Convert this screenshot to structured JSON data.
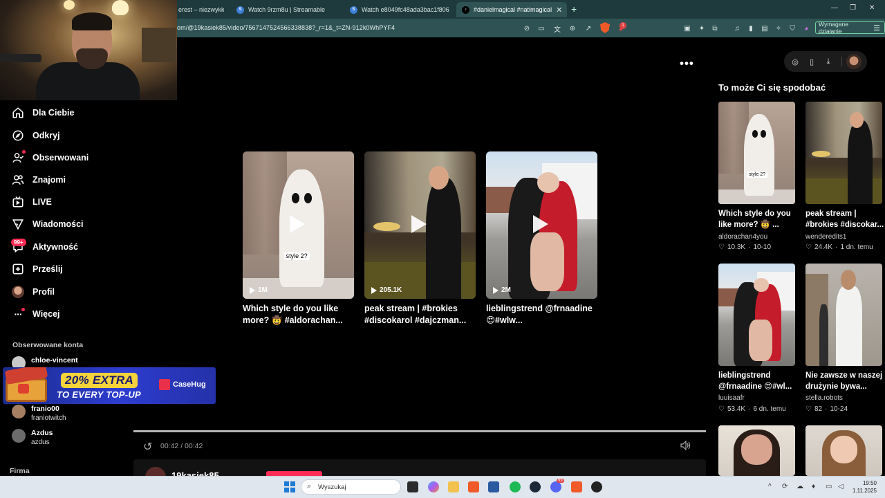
{
  "browser": {
    "tabs": [
      {
        "label": "erest – niezwykłe",
        "active": false
      },
      {
        "label": "Watch 9rzm8u | Streamable",
        "active": false
      },
      {
        "label": "Watch e8049fc48ada3bac1f8063d51",
        "active": false
      },
      {
        "label": "#danielmagical #natimagical",
        "active": true
      }
    ],
    "url": "om/@19kasiek85/video/7567147524566338838?_r=1&_t=ZN-912k0WhPYF4",
    "extension_badge": "1",
    "required_action": "Wymagane działanie"
  },
  "sidebar": {
    "items": [
      {
        "label": "Dla Ciebie",
        "icon": "home-icon"
      },
      {
        "label": "Odkryj",
        "icon": "compass-icon"
      },
      {
        "label": "Obserwowani",
        "icon": "following-icon"
      },
      {
        "label": "Znajomi",
        "icon": "friends-icon"
      },
      {
        "label": "LIVE",
        "icon": "live-tv-icon"
      },
      {
        "label": "Wiadomości",
        "icon": "messages-icon"
      },
      {
        "label": "Aktywność",
        "icon": "activity-icon"
      },
      {
        "label": "Prześlij",
        "icon": "upload-icon"
      },
      {
        "label": "Profil",
        "icon": "profile-avatar"
      },
      {
        "label": "Więcej",
        "icon": "more-icon"
      }
    ],
    "activity_badge": "99+",
    "followed_title": "Obserwowane konta",
    "followed": [
      {
        "name": "chloe-vincent",
        "handle": ""
      },
      {
        "name": "franio00",
        "handle": "franiotwitch"
      },
      {
        "name": "Azdus",
        "handle": "azdus"
      }
    ],
    "footer_title": "Firma"
  },
  "ad": {
    "headline": "20% EXTRA",
    "subline": "TO EVERY TOP-UP",
    "brand": "CaseHug"
  },
  "grid": {
    "videos": [
      {
        "views": "1M",
        "title": "Which style do you like more? 🤠 #aldorachan...",
        "thumb_label": "style 2?"
      },
      {
        "views": "205.1K",
        "title": "peak stream | #brokies #discokarol #dajczman...",
        "thumb_label": ""
      },
      {
        "views": "2M",
        "title": "lieblingstrend @frnaadine 😍#wlw...",
        "thumb_label": ""
      }
    ]
  },
  "player": {
    "time": "00:42 / 00:42",
    "progress_fraction": 1.0,
    "author": "19kasiek85"
  },
  "recommendations": {
    "title": "To może Ci się spodobać",
    "items": [
      {
        "title": "Which style do you like more? 🤠 ...",
        "author": "aldorachan4you",
        "likes": "10.3K",
        "date": "10-10",
        "thumb_label": "style 2?"
      },
      {
        "title": "peak stream | #brokies #discokar...",
        "author": "wenderedits1",
        "likes": "24.4K",
        "date": "1 dn. temu"
      },
      {
        "title": "lieblingstrend @frnaadine 😍#wl...",
        "author": "luuisaafr",
        "likes": "53.4K",
        "date": "6 dn. temu"
      },
      {
        "title": "Nie zawsze w naszej drużynie bywa...",
        "author": "stella.robots",
        "likes": "82",
        "date": "10-24"
      }
    ]
  },
  "taskbar": {
    "search_placeholder": "Wyszukaj",
    "time": "19:50",
    "date": "1.11.2025",
    "discord_badge": "99"
  }
}
